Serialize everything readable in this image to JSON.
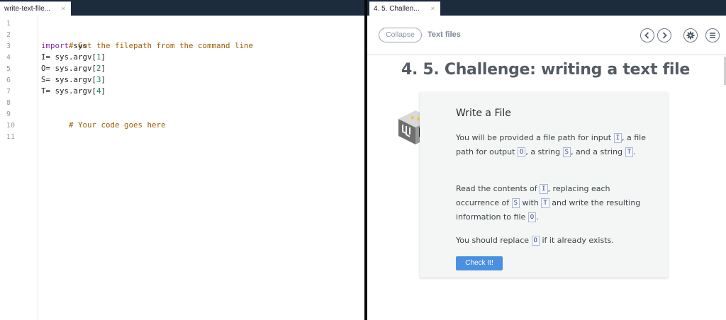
{
  "editor": {
    "tab_label": "write-text-file...",
    "tab_close": "×",
    "line_numbers": [
      "1",
      "2",
      "3",
      "4",
      "5",
      "6",
      "7",
      "8",
      "9",
      "10",
      "11"
    ],
    "code": {
      "l2": "# Get the filepath from the command line",
      "l3_kw": "import",
      "l3_rest": " sys",
      "l4_pre": "I= sys.argv[",
      "l4_num": "1",
      "l4_post": "]",
      "l5_pre": "O= sys.argv[",
      "l5_num": "2",
      "l5_post": "]",
      "l6_pre": "S= sys.argv[",
      "l6_num": "3",
      "l6_post": "]",
      "l7_pre": "T= sys.argv[",
      "l7_num": "4",
      "l7_post": "]",
      "l9": "# Your code goes here"
    }
  },
  "challenge": {
    "tab_label": "4. 5. Challen...",
    "tab_close": "×",
    "collapse_label": "Collapse",
    "breadcrumb": "Text files",
    "title": "4. 5. Challenge: writing a text file",
    "card": {
      "title": "Write a File",
      "p1": {
        "a": "You will be provided a file path for input ",
        "i": "I",
        "b": ", a file path for output ",
        "o": "O",
        "c": ", a string ",
        "s": "S",
        "d": ", and a string ",
        "t": "T",
        "e": "."
      },
      "p2": {
        "a": "Read the contents of ",
        "i": "I",
        "b": ", replacing each occurrence of ",
        "s": "S",
        "c": " with ",
        "t": "T",
        "d": " and write the resulting information to file ",
        "o": "O",
        "e": "."
      },
      "p3": {
        "a": "You should replace ",
        "o": "O",
        "b": " if it already exists."
      },
      "check_label": "Check It!"
    }
  },
  "icons": {
    "prev": "chevron-left-icon",
    "next": "chevron-right-icon",
    "settings": "gear-icon",
    "menu": "hamburger-menu-icon",
    "challenge": "circuit-cube-icon"
  },
  "colors": {
    "tabbar": "#1d2b3f",
    "accent_button": "#4a90e2",
    "comment": "#a35d00",
    "keyword": "#8a2aa6",
    "number": "#1a8a5c"
  }
}
